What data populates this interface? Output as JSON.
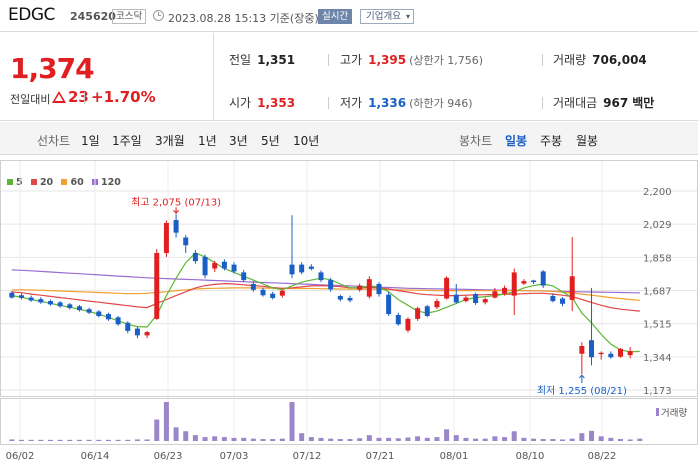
{
  "header": {
    "name": "EDGC",
    "code": "245620",
    "market": "코스닥",
    "datetime": "2023.08.28 15:13 기준(장중)",
    "realtime_label": "실시간",
    "company_label": "기업개요",
    "company_chevron": "▾"
  },
  "quote": {
    "price": "1,374",
    "compare_label": "전일대비",
    "change": "23",
    "change_pct": "+1.70%",
    "prev_close_label": "전일",
    "prev_close": "1,351",
    "high_label": "고가",
    "high": "1,395",
    "upper_limit": "(상한가 1,756)",
    "volume_label": "거래량",
    "volume": "706,004",
    "open_label": "시가",
    "open": "1,353",
    "low_label": "저가",
    "low": "1,336",
    "lower_limit": "(하한가 946)",
    "amount_label": "거래대금",
    "amount": "967",
    "amount_unit": "백만"
  },
  "tabs": {
    "line_chart": "선차트",
    "periods": [
      "1일",
      "1주일",
      "3개월",
      "1년",
      "3년",
      "5년",
      "10년"
    ],
    "candle_chart": "봉차트",
    "candle_periods": [
      "일봉",
      "주봉",
      "월봉"
    ],
    "active_candle_period": "일봉"
  },
  "colors": {
    "up": "#e02020",
    "down": "#1a5fc6",
    "ma5": "#5cb833",
    "ma20": "#e04848",
    "ma60": "#f0a030",
    "ma120": "#9a6cd0",
    "volume": "#9a86c8"
  },
  "chart_data": {
    "type": "candlestick",
    "title": "",
    "ylim": [
      1173,
      2200
    ],
    "yticks": [
      "2,200",
      "2,029",
      "1,858",
      "1,687",
      "1,515",
      "1,344",
      "1,173"
    ],
    "xticks": [
      "06/02",
      "06/14",
      "06/23",
      "07/03",
      "07/12",
      "07/21",
      "08/01",
      "08/10",
      "08/22"
    ],
    "ma_legend": [
      {
        "label": "5",
        "color": "#5cb833"
      },
      {
        "label": "20",
        "color": "#e04848"
      },
      {
        "label": "60",
        "color": "#f0a030"
      },
      {
        "label": "120",
        "color": "#9a6cd0"
      }
    ],
    "volume_label": "거래량",
    "annotations": {
      "high": "최고 2,075 (07/13)",
      "low": "최저 1,255 (08/21)"
    },
    "candles": [
      {
        "date": "06/01",
        "o": 1675,
        "h": 1683,
        "l": 1645,
        "c": 1650
      },
      {
        "date": "06/02",
        "o": 1662,
        "h": 1672,
        "l": 1640,
        "c": 1648
      },
      {
        "date": "06/05",
        "o": 1650,
        "h": 1660,
        "l": 1628,
        "c": 1635
      },
      {
        "date": "06/07",
        "o": 1642,
        "h": 1652,
        "l": 1618,
        "c": 1625
      },
      {
        "date": "06/08",
        "o": 1632,
        "h": 1640,
        "l": 1608,
        "c": 1615
      },
      {
        "date": "06/09",
        "o": 1625,
        "h": 1632,
        "l": 1598,
        "c": 1605
      },
      {
        "date": "06/12",
        "o": 1615,
        "h": 1622,
        "l": 1588,
        "c": 1596
      },
      {
        "date": "06/13",
        "o": 1605,
        "h": 1612,
        "l": 1578,
        "c": 1585
      },
      {
        "date": "06/14",
        "o": 1590,
        "h": 1598,
        "l": 1565,
        "c": 1572
      },
      {
        "date": "06/15",
        "o": 1578,
        "h": 1585,
        "l": 1548,
        "c": 1555
      },
      {
        "date": "06/16",
        "o": 1565,
        "h": 1572,
        "l": 1530,
        "c": 1538
      },
      {
        "date": "06/19",
        "o": 1548,
        "h": 1555,
        "l": 1505,
        "c": 1512
      },
      {
        "date": "06/20",
        "o": 1520,
        "h": 1528,
        "l": 1465,
        "c": 1478
      },
      {
        "date": "06/21",
        "o": 1490,
        "h": 1498,
        "l": 1440,
        "c": 1455
      },
      {
        "date": "06/22",
        "o": 1455,
        "h": 1478,
        "l": 1440,
        "c": 1472
      },
      {
        "date": "06/23",
        "o": 1540,
        "h": 1900,
        "l": 1535,
        "c": 1880
      },
      {
        "date": "06/26",
        "o": 1880,
        "h": 2048,
        "l": 1860,
        "c": 2035
      },
      {
        "date": "06/27",
        "o": 2050,
        "h": 2080,
        "l": 1960,
        "c": 1985
      },
      {
        "date": "06/28",
        "o": 1960,
        "h": 1972,
        "l": 1880,
        "c": 1920
      },
      {
        "date": "06/29",
        "o": 1880,
        "h": 1895,
        "l": 1825,
        "c": 1838
      },
      {
        "date": "06/30",
        "o": 1860,
        "h": 1872,
        "l": 1750,
        "c": 1765
      },
      {
        "date": "07/03",
        "o": 1800,
        "h": 1840,
        "l": 1782,
        "c": 1828
      },
      {
        "date": "07/04",
        "o": 1835,
        "h": 1848,
        "l": 1790,
        "c": 1800
      },
      {
        "date": "07/05",
        "o": 1820,
        "h": 1832,
        "l": 1775,
        "c": 1785
      },
      {
        "date": "07/06",
        "o": 1780,
        "h": 1792,
        "l": 1730,
        "c": 1740
      },
      {
        "date": "07/07",
        "o": 1720,
        "h": 1735,
        "l": 1680,
        "c": 1690
      },
      {
        "date": "07/10",
        "o": 1690,
        "h": 1702,
        "l": 1655,
        "c": 1662
      },
      {
        "date": "07/11",
        "o": 1670,
        "h": 1680,
        "l": 1640,
        "c": 1648
      },
      {
        "date": "07/12",
        "o": 1660,
        "h": 1690,
        "l": 1650,
        "c": 1685
      },
      {
        "date": "07/13",
        "o": 1820,
        "h": 2075,
        "l": 1750,
        "c": 1770
      },
      {
        "date": "07/14",
        "o": 1820,
        "h": 1832,
        "l": 1770,
        "c": 1780
      },
      {
        "date": "07/17",
        "o": 1810,
        "h": 1822,
        "l": 1790,
        "c": 1798
      },
      {
        "date": "07/18",
        "o": 1780,
        "h": 1790,
        "l": 1730,
        "c": 1740
      },
      {
        "date": "07/19",
        "o": 1740,
        "h": 1752,
        "l": 1680,
        "c": 1692
      },
      {
        "date": "07/20",
        "o": 1658,
        "h": 1665,
        "l": 1630,
        "c": 1640
      },
      {
        "date": "07/21",
        "o": 1648,
        "h": 1660,
        "l": 1625,
        "c": 1635
      },
      {
        "date": "07/24",
        "o": 1690,
        "h": 1722,
        "l": 1680,
        "c": 1712
      },
      {
        "date": "07/25",
        "o": 1655,
        "h": 1760,
        "l": 1645,
        "c": 1745
      },
      {
        "date": "07/26",
        "o": 1720,
        "h": 1730,
        "l": 1655,
        "c": 1668
      },
      {
        "date": "07/27",
        "o": 1665,
        "h": 1680,
        "l": 1555,
        "c": 1565
      },
      {
        "date": "07/28",
        "o": 1560,
        "h": 1572,
        "l": 1505,
        "c": 1512
      },
      {
        "date": "07/31",
        "o": 1480,
        "h": 1548,
        "l": 1470,
        "c": 1540
      },
      {
        "date": "08/01",
        "o": 1540,
        "h": 1602,
        "l": 1530,
        "c": 1595
      },
      {
        "date": "08/02",
        "o": 1605,
        "h": 1612,
        "l": 1548,
        "c": 1555
      },
      {
        "date": "08/03",
        "o": 1600,
        "h": 1645,
        "l": 1590,
        "c": 1632
      },
      {
        "date": "08/04",
        "o": 1645,
        "h": 1760,
        "l": 1640,
        "c": 1752
      },
      {
        "date": "08/07",
        "o": 1665,
        "h": 1720,
        "l": 1620,
        "c": 1625
      },
      {
        "date": "08/08",
        "o": 1632,
        "h": 1660,
        "l": 1625,
        "c": 1650
      },
      {
        "date": "08/09",
        "o": 1668,
        "h": 1675,
        "l": 1612,
        "c": 1622
      },
      {
        "date": "08/10",
        "o": 1625,
        "h": 1650,
        "l": 1615,
        "c": 1642
      },
      {
        "date": "08/11",
        "o": 1650,
        "h": 1700,
        "l": 1645,
        "c": 1682
      },
      {
        "date": "08/14",
        "o": 1670,
        "h": 1712,
        "l": 1660,
        "c": 1700
      },
      {
        "date": "08/16",
        "o": 1660,
        "h": 1800,
        "l": 1560,
        "c": 1780
      },
      {
        "date": "08/17",
        "o": 1722,
        "h": 1745,
        "l": 1715,
        "c": 1735
      },
      {
        "date": "08/18",
        "o": 1738,
        "h": 1742,
        "l": 1720,
        "c": 1730
      },
      {
        "date": "08/21",
        "o": 1785,
        "h": 1792,
        "l": 1700,
        "c": 1712
      },
      {
        "date": "08/22",
        "o": 1658,
        "h": 1672,
        "l": 1625,
        "c": 1632
      },
      {
        "date": "08/23",
        "o": 1645,
        "h": 1652,
        "l": 1605,
        "c": 1618
      },
      {
        "date": "08/24",
        "o": 1638,
        "h": 1962,
        "l": 1580,
        "c": 1760
      },
      {
        "date": "08/24b",
        "o": 1360,
        "h": 1420,
        "l": 1255,
        "c": 1400
      },
      {
        "date": "08/25",
        "o": 1430,
        "h": 1700,
        "l": 1300,
        "c": 1342
      },
      {
        "date": "08/28",
        "o": 1358,
        "h": 1372,
        "l": 1330,
        "c": 1365
      },
      {
        "date": "08/29",
        "o": 1360,
        "h": 1372,
        "l": 1335,
        "c": 1342
      },
      {
        "date": "08/30",
        "o": 1345,
        "h": 1390,
        "l": 1340,
        "c": 1385
      },
      {
        "date": "08/31",
        "o": 1353,
        "h": 1395,
        "l": 1336,
        "c": 1374
      }
    ],
    "volume": [
      4,
      3,
      3,
      3,
      3,
      3,
      3,
      3,
      3,
      3,
      3,
      3,
      3,
      4,
      4,
      55,
      100,
      35,
      25,
      15,
      10,
      12,
      10,
      8,
      8,
      6,
      5,
      5,
      6,
      100,
      20,
      10,
      8,
      6,
      5,
      5,
      7,
      15,
      8,
      8,
      7,
      9,
      12,
      8,
      10,
      30,
      15,
      8,
      6,
      6,
      12,
      10,
      25,
      8,
      6,
      5,
      5,
      4,
      6,
      20,
      26,
      12,
      8,
      5,
      4,
      6
    ],
    "ma5": [
      1660,
      1652,
      1640,
      1630,
      1620,
      1610,
      1600,
      1590,
      1578,
      1564,
      1548,
      1530,
      1512,
      1500,
      1498,
      1560,
      1660,
      1750,
      1830,
      1880,
      1860,
      1830,
      1800,
      1780,
      1760,
      1740,
      1720,
      1700,
      1690,
      1710,
      1730,
      1740,
      1750,
      1742,
      1720,
      1700,
      1700,
      1710,
      1705,
      1680,
      1640,
      1610,
      1580,
      1570,
      1580,
      1600,
      1620,
      1640,
      1650,
      1655,
      1660,
      1668,
      1680,
      1700,
      1712,
      1720,
      1710,
      1680,
      1650,
      1570,
      1520,
      1460,
      1410,
      1380,
      1370,
      1372
    ],
    "ma20": [
      1680,
      1675,
      1668,
      1662,
      1656,
      1650,
      1644,
      1638,
      1632,
      1626,
      1620,
      1614,
      1608,
      1602,
      1598,
      1620,
      1640,
      1660,
      1680,
      1700,
      1712,
      1718,
      1722,
      1720,
      1716,
      1712,
      1708,
      1702,
      1698,
      1700,
      1705,
      1710,
      1712,
      1710,
      1706,
      1700,
      1700,
      1702,
      1700,
      1694,
      1686,
      1678,
      1670,
      1665,
      1662,
      1660,
      1660,
      1662,
      1664,
      1665,
      1666,
      1667,
      1668,
      1670,
      1672,
      1672,
      1668,
      1662,
      1655,
      1640,
      1625,
      1610,
      1598,
      1590,
      1585,
      1580
    ],
    "ma60": [
      1690,
      1690,
      1689,
      1688,
      1686,
      1684,
      1682,
      1680,
      1678,
      1676,
      1674,
      1672,
      1670,
      1670,
      1672,
      1676,
      1680,
      1686,
      1690,
      1694,
      1697,
      1698,
      1699,
      1700,
      1700,
      1700,
      1699,
      1698,
      1697,
      1697,
      1697,
      1697,
      1696,
      1695,
      1694,
      1693,
      1693,
      1693,
      1692,
      1691,
      1690,
      1689,
      1688,
      1687,
      1686,
      1686,
      1686,
      1686,
      1686,
      1686,
      1686,
      1686,
      1686,
      1686,
      1685,
      1684,
      1682,
      1678,
      1674,
      1668,
      1662,
      1656,
      1650,
      1645,
      1640,
      1636
    ],
    "ma120": [
      1793,
      1791,
      1788,
      1785,
      1782,
      1779,
      1776,
      1773,
      1770,
      1767,
      1764,
      1761,
      1758,
      1755,
      1752,
      1750,
      1748,
      1746,
      1744,
      1742,
      1740,
      1738,
      1736,
      1734,
      1732,
      1730,
      1728,
      1726,
      1724,
      1722,
      1720,
      1718,
      1716,
      1714,
      1712,
      1710,
      1708,
      1706,
      1704,
      1702,
      1700,
      1698,
      1697,
      1696,
      1695,
      1694,
      1693,
      1692,
      1691,
      1690,
      1689,
      1688,
      1687,
      1686,
      1685,
      1684,
      1683,
      1682,
      1681,
      1680,
      1679,
      1678,
      1677,
      1676,
      1675,
      1674
    ]
  }
}
